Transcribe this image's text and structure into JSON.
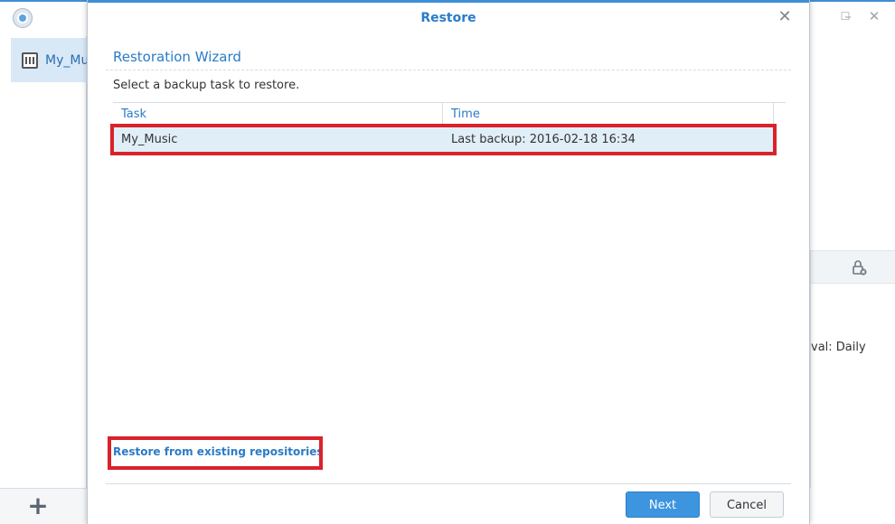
{
  "app": {
    "sidebar": {
      "items": [
        {
          "label": "My_Mu",
          "icon": "backup-task-icon"
        }
      ],
      "add_label": "+"
    },
    "window_controls": {
      "minimize": "–",
      "maximize": "☐",
      "close": "✕"
    },
    "right_panel": {
      "interval_text": "val: Daily"
    }
  },
  "dialog": {
    "title": "Restore",
    "close_label": "✕",
    "heading": "Restoration Wizard",
    "instruction": "Select a backup task to restore.",
    "table": {
      "columns": [
        "Task",
        "Time"
      ],
      "rows": [
        {
          "task": "My_Music",
          "time": "Last backup: 2016-02-18 16:34"
        }
      ]
    },
    "restore_link": "Restore from existing repositories",
    "buttons": {
      "next": "Next",
      "cancel": "Cancel"
    }
  },
  "colors": {
    "accent": "#2a7bc7",
    "highlight": "#d9222a",
    "selected_row": "#e0eef8",
    "primary_button": "#3d95e0"
  }
}
